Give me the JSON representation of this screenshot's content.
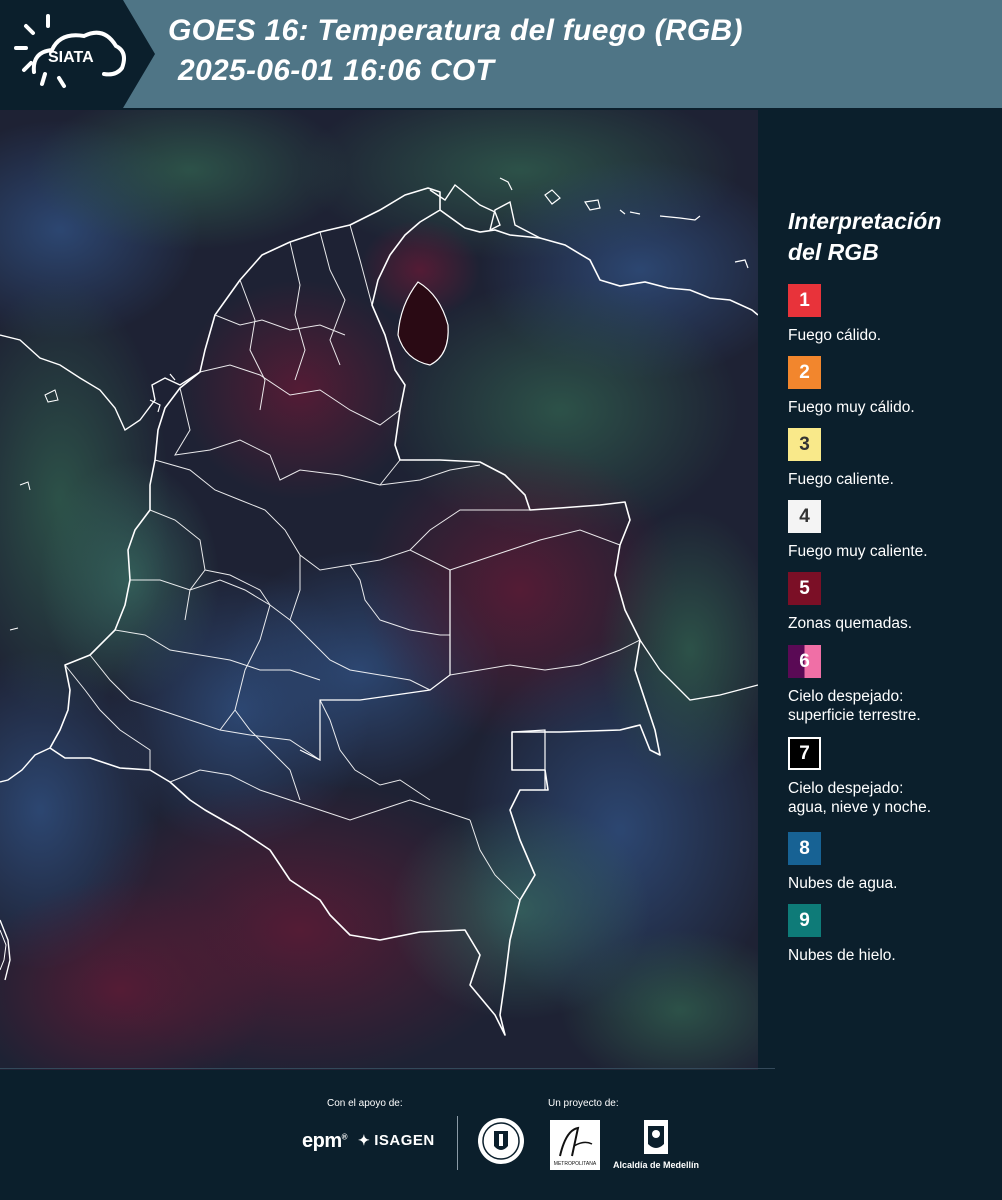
{
  "header": {
    "logo_text": "SIATA",
    "title_line1": "GOES 16: Temperatura del fuego (RGB)",
    "title_line2": "2025-06-01 16:06 COT"
  },
  "legend": {
    "title_line1": "Interpretación",
    "title_line2": "del RGB",
    "items": [
      {
        "number": "1",
        "color": "#e8333a",
        "text_color": "#ffffff",
        "lines": [
          "Fuego cálido."
        ]
      },
      {
        "number": "2",
        "color": "#f2862d",
        "text_color": "#ffffff",
        "lines": [
          "Fuego muy cálido."
        ]
      },
      {
        "number": "3",
        "color": "#f9e98a",
        "text_color": "#333333",
        "lines": [
          "Fuego caliente."
        ]
      },
      {
        "number": "4",
        "color": "#f4f4f4",
        "text_color": "#333333",
        "lines": [
          "Fuego muy caliente."
        ]
      },
      {
        "number": "5",
        "color": "#7b0f26",
        "text_color": "#ffffff",
        "lines": [
          "Zonas quemadas."
        ]
      },
      {
        "number": "6",
        "color": "#5a0a55",
        "color2": "#f06fa6",
        "text_color": "#ffffff",
        "lines": [
          "Cielo despejado:",
          "superficie terrestre."
        ]
      },
      {
        "number": "7",
        "color": "#000000",
        "text_color": "#ffffff",
        "border": "#ffffff",
        "lines": [
          "Cielo despejado:",
          "agua, nieve y noche."
        ]
      },
      {
        "number": "8",
        "color": "#176294",
        "text_color": "#ffffff",
        "lines": [
          "Nubes de agua."
        ]
      },
      {
        "number": "9",
        "color": "#0e7b78",
        "text_color": "#ffffff",
        "lines": [
          "Nubes de hielo."
        ]
      }
    ]
  },
  "footer": {
    "support_label": "Con el apoyo de:",
    "project_label": "Un proyecto de:",
    "epm": "epm",
    "isagen": "ISAGEN",
    "area_name": "METROPOLITANA",
    "alcaldia": "Alcaldía de Medellín"
  },
  "colors": {
    "background": "#0b1f2c",
    "banner": "#4f7586",
    "map_base": "#1c2234",
    "borders": "#ffffff"
  }
}
